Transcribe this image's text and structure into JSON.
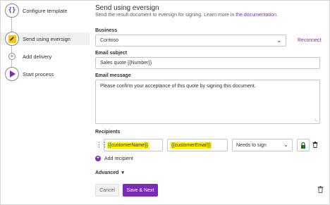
{
  "stepper": {
    "steps": [
      {
        "label": "Configure template",
        "icon": "braces-icon",
        "glyph": "{}"
      },
      {
        "label": "Send using eversign",
        "icon": "edit-icon",
        "active": true
      },
      {
        "label": "Add delivery",
        "icon": "plus-icon",
        "glyph": "+"
      },
      {
        "label": "Start process",
        "icon": "play-icon"
      }
    ]
  },
  "header": {
    "title": "Send using eversign",
    "subtitle_prefix": "Send the result document to eversign for signing. Learn more in ",
    "subtitle_link": "the documentation",
    "subtitle_suffix": "."
  },
  "business": {
    "label": "Business",
    "value": "Contoso",
    "reconnect": "Reconnect"
  },
  "email_subject": {
    "label": "Email subject",
    "value": "Sales quote {{Number}}"
  },
  "email_message": {
    "label": "Email message",
    "value": "Please confirm your acceptance of this quote by signing this document."
  },
  "recipients": {
    "label": "Recipients",
    "rows": [
      {
        "name": "{{customerName}}",
        "email": "{{customerEmail}}",
        "role": "Needs to sign"
      }
    ],
    "add_label": "Add recipient",
    "add_glyph": "+"
  },
  "advanced": {
    "label": "Advanced"
  },
  "footer": {
    "cancel": "Cancel",
    "save": "Save & Next"
  },
  "colors": {
    "accent": "#7b2bb8",
    "highlight": "#fff200",
    "active_step_bg": "#f0f0f0",
    "lock_green": "#107c10"
  }
}
